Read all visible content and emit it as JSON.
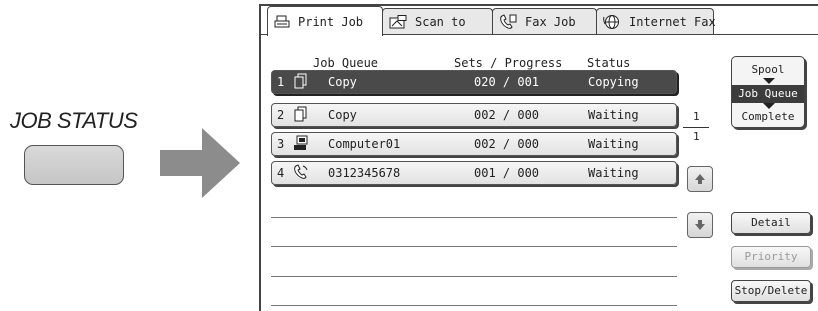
{
  "guide": {
    "label": "JOB STATUS",
    "hardware_button": "job-status-key"
  },
  "tabs": [
    {
      "label": "Print Job",
      "icon": "printer-icon",
      "active": true
    },
    {
      "label": "Scan to",
      "icon": "scan-icon",
      "active": false
    },
    {
      "label": "Fax Job",
      "icon": "fax-phone-icon",
      "active": false
    },
    {
      "label": "Internet Fax",
      "icon": "internet-fax-icon",
      "active": false
    }
  ],
  "columns": {
    "queue": "Job Queue",
    "sets": "Sets / Progress",
    "status": "Status"
  },
  "jobs": [
    {
      "num": "1",
      "icon": "copy-icon",
      "name": "Copy",
      "sets": "020 / 001",
      "status": "Copying",
      "selected": true
    },
    {
      "num": "2",
      "icon": "copy-icon",
      "name": "Copy",
      "sets": "002 / 000",
      "status": "Waiting",
      "selected": false
    },
    {
      "num": "3",
      "icon": "computer-icon",
      "name": "Computer01",
      "sets": "002 / 000",
      "status": "Waiting",
      "selected": false
    },
    {
      "num": "4",
      "icon": "fax-icon",
      "name": "0312345678",
      "sets": "001 / 000",
      "status": "Waiting",
      "selected": false
    }
  ],
  "pagination": {
    "current": "1",
    "total": "1"
  },
  "mode": {
    "items": [
      "Spool",
      "Job Queue",
      "Complete"
    ],
    "selected": "Job Queue"
  },
  "buttons": {
    "detail": "Detail",
    "priority": "Priority",
    "stop_delete": "Stop/Delete"
  },
  "colors": {
    "selected_row": "#4a4a4a",
    "arrow": "#8c8c8c"
  }
}
